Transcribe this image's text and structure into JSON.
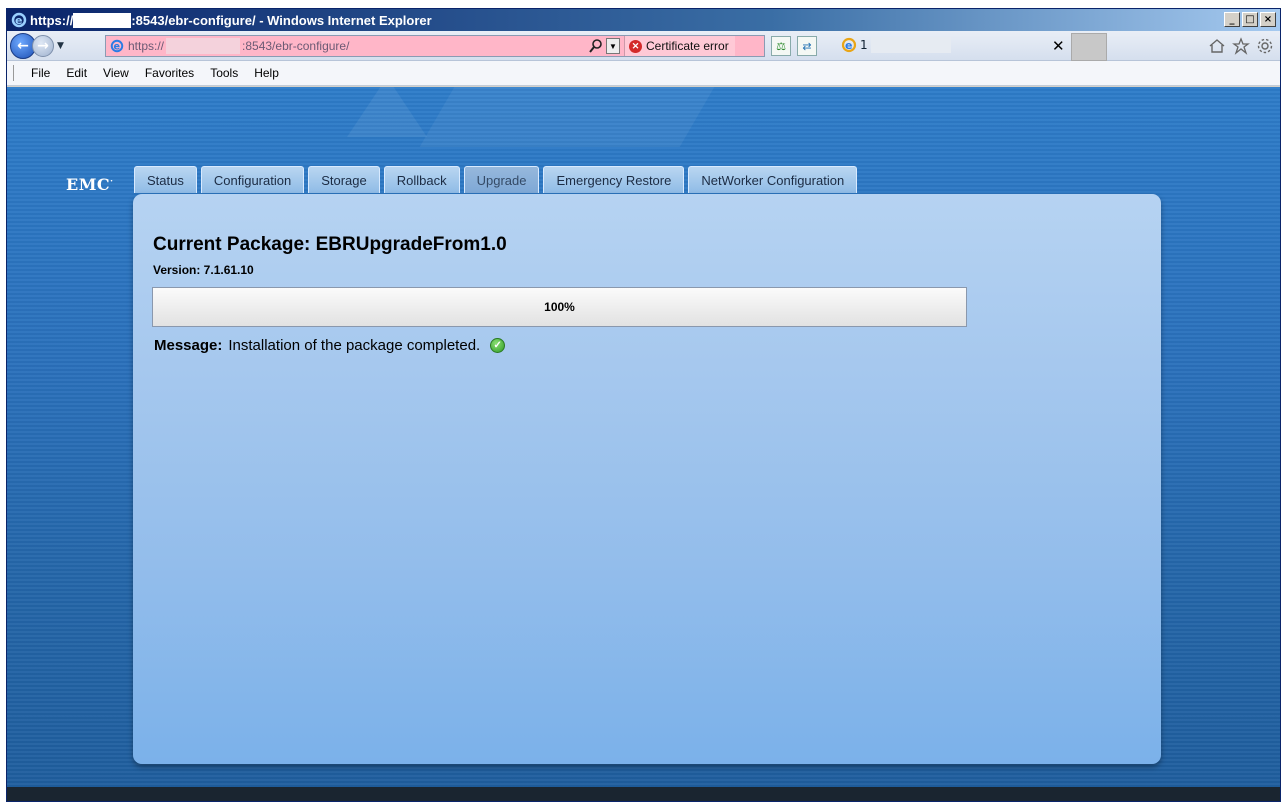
{
  "window": {
    "title_prefix": "https://",
    "title_suffix": ":8543/ebr-configure/ - Windows Internet Explorer",
    "controls": {
      "minimize": "_",
      "maximize": "□",
      "close": "×"
    }
  },
  "toolbar": {
    "address_prefix": "https://",
    "address_suffix": ":8543/ebr-configure/",
    "certificate_error": "Certificate error",
    "tab_label": "1"
  },
  "menu": {
    "items": [
      "File",
      "Edit",
      "View",
      "Favorites",
      "Tools",
      "Help"
    ]
  },
  "app": {
    "logo": "EMC",
    "tabs": [
      {
        "label": "Status"
      },
      {
        "label": "Configuration"
      },
      {
        "label": "Storage"
      },
      {
        "label": "Rollback"
      },
      {
        "label": "Upgrade",
        "active": true
      },
      {
        "label": "Emergency Restore"
      },
      {
        "label": "NetWorker Configuration"
      }
    ]
  },
  "package": {
    "title": "Current Package: EBRUpgradeFrom1.0",
    "version": "Version: 7.1.61.10",
    "progress_percent": 100,
    "progress_label": "100%",
    "message_label": "Message:",
    "message_text": "Installation of the package completed."
  },
  "colors": {
    "accent": "#2d7cc9",
    "panel": "#a6c8ee",
    "address_error": "#ffb6c8",
    "success": "#2f9a27"
  },
  "icons": {
    "back": "back-arrow-icon",
    "forward": "forward-arrow-icon",
    "search": "search-icon",
    "cert_error": "cert-error-icon",
    "home": "home-icon",
    "favorites": "star-icon",
    "tools": "gear-icon",
    "success": "checkmark-icon"
  }
}
